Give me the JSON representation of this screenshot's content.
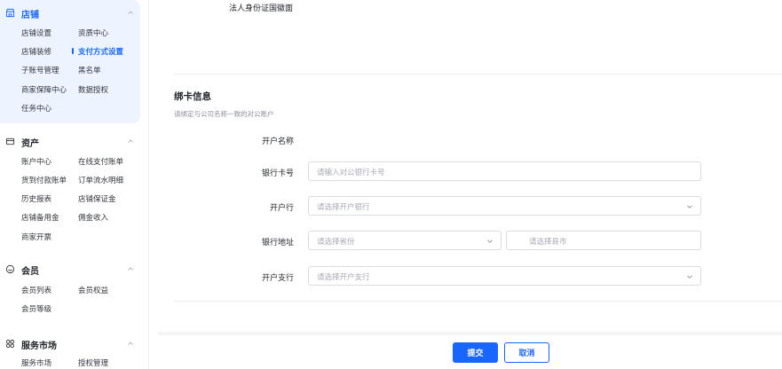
{
  "sidebar": {
    "groups": [
      {
        "title": "店铺",
        "icon": "store-icon",
        "items": [
          [
            "店铺设置",
            "资质中心"
          ],
          [
            "店铺装修",
            "支付方式设置"
          ],
          [
            "子账号管理",
            "黑名单"
          ],
          [
            "商家保障中心",
            "数据授权"
          ],
          [
            "任务中心"
          ]
        ]
      },
      {
        "title": "资产",
        "icon": "wallet-icon",
        "items": [
          [
            "账户中心",
            "在线支付账单"
          ],
          [
            "货到付款账单",
            "订单流水明细"
          ],
          [
            "历史报表",
            "店铺保证金"
          ],
          [
            "店铺备用金",
            "佣金收入"
          ],
          [
            "商家开票"
          ]
        ]
      },
      {
        "title": "会员",
        "icon": "member-icon",
        "items": [
          [
            "会员列表",
            "会员权益"
          ],
          [
            "会员等级"
          ]
        ]
      },
      {
        "title": "服务市场",
        "icon": "market-icon",
        "items": [
          [
            "服务市场",
            "授权管理"
          ]
        ]
      }
    ]
  },
  "main": {
    "top_label": "法人身份证国徽面",
    "section": {
      "title": "绑卡信息",
      "subtitle": "请绑定与公司名称一致的对公账户"
    },
    "fields": {
      "account_name": {
        "label": "开户名称"
      },
      "card_number": {
        "label": "银行卡号",
        "placeholder": "请输入对公银行卡号"
      },
      "bank": {
        "label": "开户行",
        "placeholder": "请选择开户银行"
      },
      "address": {
        "label": "银行地址",
        "province_placeholder": "请选择省份",
        "city_placeholder": "请选择县市"
      },
      "branch": {
        "label": "开户支行",
        "placeholder": "请选择开户支行"
      }
    }
  },
  "footer": {
    "submit_label": "提交",
    "cancel_label": "取消"
  },
  "colors": {
    "accent": "#1966ff",
    "active_bg": "#eef4ff"
  }
}
